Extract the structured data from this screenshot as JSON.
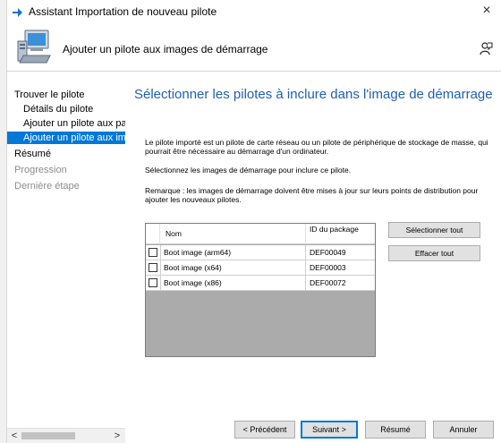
{
  "window": {
    "title": "Assistant Importation de nouveau pilote",
    "close_glyph": "×"
  },
  "header": {
    "title": "Ajouter un pilote aux images de démarrage"
  },
  "nav": {
    "items": [
      {
        "label": "Trouver le pilote",
        "state": "normal"
      },
      {
        "label": "Détails du pilote",
        "state": "normal"
      },
      {
        "label": "Ajouter un pilote aux packages",
        "state": "normal"
      },
      {
        "label": "Ajouter un pilote aux images de démarrage",
        "state": "selected"
      },
      {
        "label": "Résumé",
        "state": "normal"
      },
      {
        "label": "Progression",
        "state": "disabled"
      },
      {
        "label": "Dernière étape",
        "state": "disabled"
      }
    ],
    "scroll_left": "<",
    "scroll_right": ">"
  },
  "content": {
    "heading": "Sélectionner les pilotes à inclure dans l'image de démarrage",
    "para1": "Le pilote importé est un pilote de carte réseau ou un pilote de périphérique de stockage de masse, qui pourrait être nécessaire au démarrage d'un ordinateur.",
    "para2": "Sélectionnez les images de démarrage pour inclure ce pilote.",
    "para3": "Remarque : les images de démarrage doivent être mises à jour sur leurs points de distribution pour ajouter les nouveaux pilotes."
  },
  "grid": {
    "col_name": "Nom",
    "col_id": "ID du package",
    "rows": [
      {
        "name": "Boot image (arm64)",
        "id": "DEF00049",
        "checked": false
      },
      {
        "name": "Boot image (x64)",
        "id": "DEF00003",
        "checked": false
      },
      {
        "name": "Boot image (x86)",
        "id": "DEF00072",
        "checked": false
      }
    ]
  },
  "buttons": {
    "select_all": "Sélectionner tout",
    "clear_all": "Effacer tout",
    "previous": "< Précédent",
    "next": "Suivant >",
    "summary": "Résumé",
    "cancel": "Annuler"
  },
  "colors": {
    "accent": "#0078d7",
    "heading": "#1e5fb4",
    "grid_empty": "#ababab"
  },
  "icons": {
    "app": "wizard-arrow-icon",
    "header": "computer-icon",
    "help": "help-person-icon"
  }
}
